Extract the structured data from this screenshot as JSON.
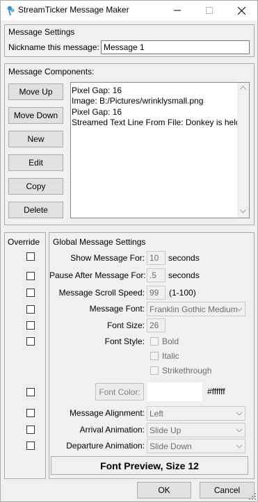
{
  "window": {
    "title": "StreamTicker Message Maker",
    "minimize_icon": "minimize-icon",
    "maximize_icon": "maximize-icon",
    "close_icon": "close-icon"
  },
  "message_settings": {
    "group_title": "Message Settings",
    "nickname_label": "Nickname this message:",
    "nickname_value": "Message 1"
  },
  "components": {
    "group_title": "Message Components:",
    "buttons": {
      "move_up": "Move Up",
      "move_down": "Move Down",
      "new": "New",
      "edit": "Edit",
      "copy": "Copy",
      "delete": "Delete"
    },
    "items": [
      "Pixel Gap: 16",
      "Image: B:/Pictures/wrinklysmall.png",
      "Pixel Gap: 16",
      "Streamed Text Line From File: Donkey is held b"
    ]
  },
  "override": {
    "title": "Override"
  },
  "global": {
    "group_title": "Global Message Settings",
    "show_for_label": "Show Message For:",
    "show_for_value": "10",
    "show_for_unit": "seconds",
    "pause_label": "Pause After Message For:",
    "pause_value": ".5",
    "pause_unit": "seconds",
    "scroll_label": "Message Scroll Speed:",
    "scroll_value": "99",
    "scroll_range": "(1-100)",
    "font_label": "Message Font:",
    "font_value": "Franklin Gothic Medium",
    "font_size_label": "Font Size:",
    "font_size_value": "26",
    "font_style_label": "Font Style:",
    "bold": "Bold",
    "italic": "Italic",
    "strikethrough": "Strikethrough",
    "font_color_button": "Font Color:",
    "font_color_value": "#ffffff",
    "alignment_label": "Message Alignment:",
    "alignment_value": "Left",
    "arrival_label": "Arrival Animation:",
    "arrival_value": "Slide Up",
    "departure_label": "Departure Animation:",
    "departure_value": "Slide Down",
    "preview": "Font Preview, Size 12"
  },
  "footer": {
    "ok": "OK",
    "cancel": "Cancel"
  }
}
